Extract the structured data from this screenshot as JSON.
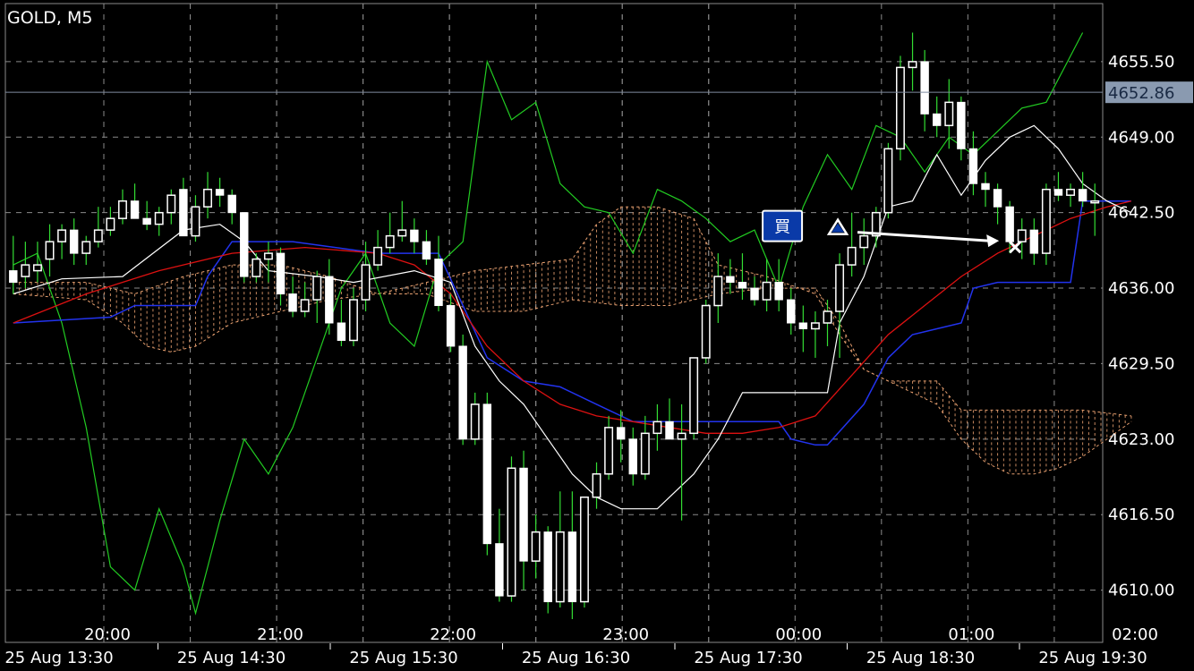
{
  "header": {
    "title": "GOLD, M5"
  },
  "colors": {
    "background": "#000000",
    "grid": "#8a8a8a",
    "candle_bull": "#ffffff",
    "candle_bear": "#ffffff",
    "wick": "#33dd33",
    "chikou": "#22cc22",
    "tenkan": "#ffffff",
    "kijun": "#2233ee",
    "ma": "#dd1111",
    "cloud": "#e8a070",
    "current_price_line": "#7f8ca0",
    "current_price_box": "#8a9ab0",
    "buy_badge": "#0a3aa8"
  },
  "chart_data": {
    "type": "candlestick",
    "symbol": "GOLD",
    "timeframe": "M5",
    "current_price": "4652.86",
    "y_ticks": [
      "4655.50",
      "4649.00",
      "4642.50",
      "4636.00",
      "4629.50",
      "4623.00",
      "4616.50",
      "4610.00"
    ],
    "ylim": [
      4605.5,
      4660.5
    ],
    "x_time_labels": [
      "20:00",
      "21:00",
      "22:00",
      "23:00",
      "00:00",
      "01:00",
      "02:00"
    ],
    "x_date_labels": [
      "25 Aug 13:30",
      "25 Aug 14:30",
      "25 Aug 15:30",
      "25 Aug 16:30",
      "25 Aug 17:30",
      "25 Aug 18:30",
      "25 Aug 19:30"
    ],
    "candles": [
      [
        4637.5,
        4640.5,
        4635.5,
        4636.5
      ],
      [
        4637.0,
        4640.0,
        4636.0,
        4638.0
      ],
      [
        4637.5,
        4640.0,
        4636.5,
        4638.0
      ],
      [
        4638.5,
        4641.5,
        4637.0,
        4640.0
      ],
      [
        4640.0,
        4641.5,
        4638.5,
        4641.0
      ],
      [
        4641.0,
        4642.0,
        4638.0,
        4639.0
      ],
      [
        4639.0,
        4640.5,
        4638.0,
        4640.0
      ],
      [
        4640.0,
        4643.0,
        4639.5,
        4641.0
      ],
      [
        4641.0,
        4643.0,
        4640.5,
        4642.0
      ],
      [
        4642.0,
        4644.5,
        4641.5,
        4643.5
      ],
      [
        4643.5,
        4645.0,
        4642.0,
        4642.0
      ],
      [
        4642.0,
        4643.5,
        4641.0,
        4641.5
      ],
      [
        4641.5,
        4643.0,
        4640.5,
        4642.5
      ],
      [
        4642.5,
        4644.5,
        4641.5,
        4644.0
      ],
      [
        4644.5,
        4645.5,
        4640.5,
        4640.5
      ],
      [
        4640.5,
        4644.0,
        4640.0,
        4643.0
      ],
      [
        4643.0,
        4646.0,
        4642.0,
        4644.5
      ],
      [
        4644.5,
        4645.5,
        4643.0,
        4644.0
      ],
      [
        4644.0,
        4644.5,
        4641.5,
        4642.5
      ],
      [
        4642.5,
        4642.5,
        4636.5,
        4637.0
      ],
      [
        4637.0,
        4639.0,
        4636.5,
        4638.5
      ],
      [
        4638.5,
        4640.0,
        4636.5,
        4639.0
      ],
      [
        4639.0,
        4639.5,
        4634.5,
        4635.5
      ],
      [
        4635.5,
        4637.0,
        4633.5,
        4634.0
      ],
      [
        4634.0,
        4636.5,
        4633.5,
        4635.0
      ],
      [
        4635.0,
        4637.5,
        4633.0,
        4637.0
      ],
      [
        4637.0,
        4638.5,
        4632.0,
        4633.0
      ],
      [
        4633.0,
        4635.0,
        4631.0,
        4631.5
      ],
      [
        4631.5,
        4636.0,
        4631.0,
        4635.0
      ],
      [
        4635.0,
        4640.0,
        4634.0,
        4638.0
      ],
      [
        4638.0,
        4641.0,
        4637.5,
        4639.5
      ],
      [
        4639.5,
        4642.5,
        4639.0,
        4640.5
      ],
      [
        4640.5,
        4643.5,
        4640.0,
        4641.0
      ],
      [
        4641.0,
        4642.0,
        4639.0,
        4640.0
      ],
      [
        4640.0,
        4641.0,
        4638.0,
        4638.5
      ],
      [
        4638.5,
        4640.5,
        4634.0,
        4634.5
      ],
      [
        4634.5,
        4635.5,
        4630.5,
        4631.0
      ],
      [
        4631.0,
        4632.0,
        4622.5,
        4623.0
      ],
      [
        4623.0,
        4627.0,
        4622.5,
        4626.0
      ],
      [
        4626.0,
        4627.0,
        4613.0,
        4614.0
      ],
      [
        4614.0,
        4617.0,
        4609.0,
        4609.5
      ],
      [
        4609.5,
        4621.5,
        4609.0,
        4620.5
      ],
      [
        4620.5,
        4622.0,
        4610.0,
        4612.5
      ],
      [
        4612.5,
        4616.5,
        4611.0,
        4615.0
      ],
      [
        4615.0,
        4615.5,
        4608.0,
        4609.0
      ],
      [
        4609.0,
        4618.5,
        4608.5,
        4615.0
      ],
      [
        4615.0,
        4618.5,
        4607.5,
        4609.0
      ],
      [
        4609.0,
        4616.5,
        4608.5,
        4618.0
      ],
      [
        4618.0,
        4621.0,
        4617.0,
        4620.0
      ],
      [
        4620.0,
        4625.0,
        4619.5,
        4624.0
      ],
      [
        4624.0,
        4625.5,
        4621.0,
        4623.0
      ],
      [
        4623.0,
        4624.0,
        4619.0,
        4620.0
      ],
      [
        4620.0,
        4625.0,
        4619.5,
        4623.5
      ],
      [
        4623.5,
        4626.0,
        4622.0,
        4624.5
      ],
      [
        4624.5,
        4626.5,
        4623.0,
        4623.0
      ],
      [
        4623.0,
        4626.0,
        4616.0,
        4623.5
      ],
      [
        4623.5,
        4630.0,
        4623.0,
        4630.0
      ],
      [
        4630.0,
        4635.0,
        4629.5,
        4634.5
      ],
      [
        4634.5,
        4639.0,
        4633.0,
        4637.0
      ],
      [
        4637.0,
        4638.5,
        4635.5,
        4636.5
      ],
      [
        4636.5,
        4639.0,
        4635.0,
        4636.0
      ],
      [
        4636.0,
        4637.0,
        4634.5,
        4635.0
      ],
      [
        4635.0,
        4638.5,
        4634.0,
        4636.5
      ],
      [
        4636.5,
        4638.5,
        4634.0,
        4635.0
      ],
      [
        4635.0,
        4636.0,
        4632.0,
        4633.0
      ],
      [
        4633.0,
        4634.5,
        4630.5,
        4632.5
      ],
      [
        4632.5,
        4634.0,
        4630.0,
        4633.0
      ],
      [
        4633.0,
        4635.0,
        4631.0,
        4634.0
      ],
      [
        4634.0,
        4639.0,
        4630.0,
        4638.0
      ],
      [
        4638.0,
        4642.5,
        4637.0,
        4639.5
      ],
      [
        4639.5,
        4642.0,
        4638.0,
        4640.5
      ],
      [
        4640.5,
        4643.0,
        4639.5,
        4642.5
      ],
      [
        4642.5,
        4648.5,
        4642.0,
        4648.0
      ],
      [
        4648.0,
        4656.0,
        4647.0,
        4655.0
      ],
      [
        4655.0,
        4658.0,
        4653.0,
        4655.5
      ],
      [
        4655.5,
        4656.5,
        4649.5,
        4651.0
      ],
      [
        4651.0,
        4652.5,
        4649.0,
        4650.0
      ],
      [
        4650.0,
        4654.0,
        4648.0,
        4652.0
      ],
      [
        4652.0,
        4652.5,
        4647.0,
        4648.0
      ],
      [
        4648.0,
        4649.5,
        4644.0,
        4645.0
      ],
      [
        4645.0,
        4646.0,
        4643.0,
        4644.5
      ],
      [
        4644.5,
        4645.0,
        4641.5,
        4643.0
      ],
      [
        4643.0,
        4643.5,
        4639.0,
        4640.0
      ],
      [
        4640.0,
        4642.0,
        4638.5,
        4641.0
      ],
      [
        4641.0,
        4642.0,
        4638.0,
        4639.0
      ],
      [
        4639.0,
        4645.0,
        4638.0,
        4644.5
      ],
      [
        4644.5,
        4646.0,
        4643.5,
        4644.0
      ],
      [
        4644.0,
        4645.0,
        4643.0,
        4644.5
      ],
      [
        4644.5,
        4646.0,
        4643.0,
        4643.5
      ],
      [
        4643.5,
        4645.0,
        4640.5,
        4643.5
      ]
    ],
    "tenkan": [
      [
        0,
        4635.5
      ],
      [
        4,
        4636.8
      ],
      [
        9,
        4637.0
      ],
      [
        14,
        4641.0
      ],
      [
        17,
        4641.5
      ],
      [
        19,
        4640.0
      ],
      [
        21,
        4637.5
      ],
      [
        25,
        4637.0
      ],
      [
        28,
        4636.5
      ],
      [
        33,
        4637.5
      ],
      [
        36,
        4636.5
      ],
      [
        38,
        4631.0
      ],
      [
        40,
        4628.0
      ],
      [
        42,
        4626.0
      ],
      [
        44,
        4623.0
      ],
      [
        46,
        4620.0
      ],
      [
        48,
        4618.0
      ],
      [
        50,
        4617.0
      ],
      [
        53,
        4617.0
      ],
      [
        56,
        4620.0
      ],
      [
        58,
        4623.0
      ],
      [
        60,
        4627.0
      ],
      [
        63,
        4627.0
      ],
      [
        66,
        4627.0
      ],
      [
        67,
        4627.0
      ],
      [
        68,
        4633.0
      ],
      [
        70,
        4637.0
      ],
      [
        72,
        4643.0
      ],
      [
        74,
        4643.5
      ],
      [
        76,
        4647.5
      ],
      [
        78,
        4644.0
      ],
      [
        80,
        4647.0
      ],
      [
        82,
        4649.0
      ],
      [
        84,
        4650.0
      ],
      [
        86,
        4648.0
      ],
      [
        88,
        4645.0
      ],
      [
        90,
        4643.5
      ],
      [
        92,
        4642.5
      ]
    ],
    "kijun": [
      [
        0,
        4633.0
      ],
      [
        8,
        4633.5
      ],
      [
        10,
        4634.5
      ],
      [
        15,
        4634.5
      ],
      [
        16,
        4637.0
      ],
      [
        18,
        4640.0
      ],
      [
        23,
        4640.0
      ],
      [
        30,
        4639.0
      ],
      [
        35,
        4639.0
      ],
      [
        37,
        4634.5
      ],
      [
        39,
        4630.0
      ],
      [
        42,
        4628.0
      ],
      [
        45,
        4627.5
      ],
      [
        48,
        4626.0
      ],
      [
        51,
        4624.5
      ],
      [
        55,
        4624.5
      ],
      [
        63,
        4624.5
      ],
      [
        64,
        4623.0
      ],
      [
        66,
        4622.5
      ],
      [
        67,
        4622.5
      ],
      [
        70,
        4626.0
      ],
      [
        72,
        4630.0
      ],
      [
        74,
        4632.0
      ],
      [
        76,
        4632.5
      ],
      [
        78,
        4633.0
      ],
      [
        79,
        4636.0
      ],
      [
        81,
        4636.5
      ],
      [
        84,
        4636.5
      ],
      [
        87,
        4636.5
      ],
      [
        88,
        4643.5
      ],
      [
        92,
        4643.5
      ]
    ],
    "chikou": [
      [
        0,
        4638.0
      ],
      [
        2,
        4639.0
      ],
      [
        4,
        4633.0
      ],
      [
        6,
        4624.0
      ],
      [
        8,
        4612.0
      ],
      [
        10,
        4610.0
      ],
      [
        12,
        4617.0
      ],
      [
        14,
        4612.0
      ],
      [
        15,
        4608.0
      ],
      [
        17,
        4616.0
      ],
      [
        19,
        4623.0
      ],
      [
        21,
        4620.0
      ],
      [
        23,
        4624.0
      ],
      [
        25,
        4630.0
      ],
      [
        27,
        4636.0
      ],
      [
        29,
        4639.0
      ],
      [
        31,
        4633.0
      ],
      [
        33,
        4631.0
      ],
      [
        35,
        4638.0
      ],
      [
        37,
        4640.0
      ],
      [
        39,
        4655.5
      ],
      [
        41,
        4650.5
      ],
      [
        43,
        4652.0
      ],
      [
        45,
        4645.0
      ],
      [
        47,
        4643.0
      ],
      [
        49,
        4642.5
      ],
      [
        51,
        4639.0
      ],
      [
        53,
        4644.5
      ],
      [
        55,
        4643.5
      ],
      [
        57,
        4642.0
      ],
      [
        59,
        4640.0
      ],
      [
        61,
        4641.0
      ],
      [
        63,
        4636.0
      ],
      [
        65,
        4643.0
      ],
      [
        67,
        4647.5
      ],
      [
        69,
        4644.5
      ],
      [
        71,
        4650.0
      ],
      [
        73,
        4649.0
      ],
      [
        75,
        4646.0
      ],
      [
        77,
        4649.0
      ],
      [
        79,
        4647.5
      ],
      [
        81,
        4649.5
      ],
      [
        83,
        4651.5
      ],
      [
        85,
        4652.0
      ],
      [
        87,
        4656.0
      ],
      [
        88,
        4658.0
      ]
    ],
    "ma": [
      [
        0,
        4633.0
      ],
      [
        6,
        4635.5
      ],
      [
        12,
        4637.5
      ],
      [
        18,
        4639.0
      ],
      [
        24,
        4639.5
      ],
      [
        30,
        4639.0
      ],
      [
        33,
        4638.0
      ],
      [
        36,
        4635.5
      ],
      [
        39,
        4631.0
      ],
      [
        42,
        4628.0
      ],
      [
        45,
        4626.0
      ],
      [
        48,
        4625.0
      ],
      [
        51,
        4624.5
      ],
      [
        54,
        4624.0
      ],
      [
        57,
        4623.5
      ],
      [
        60,
        4623.5
      ],
      [
        63,
        4624.0
      ],
      [
        66,
        4625.0
      ],
      [
        69,
        4628.5
      ],
      [
        72,
        4632.0
      ],
      [
        75,
        4634.5
      ],
      [
        78,
        4637.0
      ],
      [
        81,
        4639.0
      ],
      [
        84,
        4640.5
      ],
      [
        87,
        4642.0
      ],
      [
        90,
        4643.0
      ],
      [
        92,
        4643.5
      ]
    ],
    "cloud_top": [
      [
        0,
        4636.5
      ],
      [
        6,
        4636.5
      ],
      [
        10,
        4635.5
      ],
      [
        14,
        4637.0
      ],
      [
        18,
        4638.0
      ],
      [
        22,
        4638.0
      ],
      [
        26,
        4637.0
      ],
      [
        30,
        4635.5
      ],
      [
        34,
        4636.5
      ],
      [
        38,
        4637.5
      ],
      [
        42,
        4638.0
      ],
      [
        46,
        4638.5
      ],
      [
        48,
        4641.5
      ],
      [
        50,
        4643.0
      ],
      [
        53,
        4643.0
      ],
      [
        56,
        4642.0
      ],
      [
        58,
        4638.0
      ],
      [
        62,
        4637.0
      ],
      [
        66,
        4635.5
      ],
      [
        68,
        4632.0
      ],
      [
        70,
        4629.0
      ],
      [
        72,
        4628.0
      ],
      [
        74,
        4628.0
      ],
      [
        76,
        4628.0
      ],
      [
        78,
        4625.5
      ],
      [
        80,
        4625.5
      ],
      [
        84,
        4625.5
      ],
      [
        88,
        4625.5
      ],
      [
        92,
        4625.0
      ]
    ],
    "cloud_bottom": [
      [
        0,
        4635.5
      ],
      [
        6,
        4635.0
      ],
      [
        9,
        4633.0
      ],
      [
        11,
        4631.0
      ],
      [
        13,
        4630.5
      ],
      [
        15,
        4631.0
      ],
      [
        18,
        4633.0
      ],
      [
        22,
        4634.0
      ],
      [
        26,
        4635.0
      ],
      [
        30,
        4635.5
      ],
      [
        34,
        4635.5
      ],
      [
        38,
        4634.0
      ],
      [
        42,
        4634.0
      ],
      [
        46,
        4635.0
      ],
      [
        50,
        4634.5
      ],
      [
        54,
        4634.5
      ],
      [
        58,
        4635.5
      ],
      [
        62,
        4636.0
      ],
      [
        66,
        4636.0
      ],
      [
        68,
        4633.0
      ],
      [
        70,
        4629.0
      ],
      [
        72,
        4628.0
      ],
      [
        74,
        4627.0
      ],
      [
        76,
        4626.0
      ],
      [
        78,
        4623.0
      ],
      [
        80,
        4621.0
      ],
      [
        82,
        4620.0
      ],
      [
        84,
        4620.0
      ],
      [
        86,
        4620.5
      ],
      [
        88,
        4621.5
      ],
      [
        92,
        4624.5
      ]
    ],
    "trade": {
      "badge": "買",
      "entry": [
        68,
        4640.5
      ],
      "exit": [
        82,
        4640.0
      ]
    }
  }
}
